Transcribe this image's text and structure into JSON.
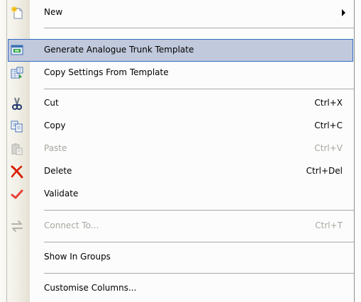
{
  "menu": {
    "items": [
      {
        "label": "New",
        "icon": "new-item-icon",
        "submenu": true
      },
      {
        "label": "Generate Analogue Trunk Template",
        "icon": "generate-template-icon",
        "highlighted": true
      },
      {
        "label": "Copy Settings From Template",
        "icon": "copy-settings-icon"
      },
      {
        "label": "Cut",
        "shortcut": "Ctrl+X",
        "icon": "scissors-icon"
      },
      {
        "label": "Copy",
        "shortcut": "Ctrl+C",
        "icon": "copy-icon"
      },
      {
        "label": "Paste",
        "shortcut": "Ctrl+V",
        "icon": "paste-icon",
        "disabled": true
      },
      {
        "label": "Delete",
        "shortcut": "Ctrl+Del",
        "icon": "delete-x-icon"
      },
      {
        "label": "Validate",
        "icon": "checkmark-icon"
      },
      {
        "label": "Connect To...",
        "shortcut": "Ctrl+T",
        "icon": "connect-arrows-icon",
        "disabled": true
      },
      {
        "label": "Show In Groups"
      },
      {
        "label": "Customise Columns..."
      }
    ]
  },
  "colors": {
    "highlight": "#c1c9dc",
    "highlight_border": "#316ac5",
    "disabled_text": "#a7a69f",
    "delete_red": "#d81e05",
    "validate_red": "#e8413a"
  }
}
